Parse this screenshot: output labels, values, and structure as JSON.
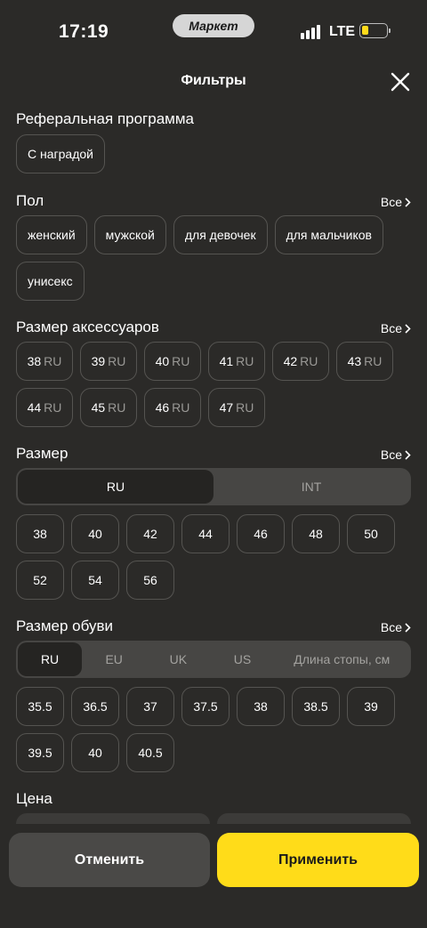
{
  "status_bar": {
    "time": "17:19",
    "brand": "Маркет",
    "network": "LTE",
    "battery_level": 0.25
  },
  "header": {
    "title": "Фильтры",
    "close_icon": "close-icon"
  },
  "see_all_label": "Все",
  "referral": {
    "title": "Реферальная программа",
    "chips": [
      "С наградой"
    ]
  },
  "gender": {
    "title": "Пол",
    "chips": [
      "женский",
      "мужской",
      "для девочек",
      "для мальчиков",
      "унисекс"
    ]
  },
  "accessory_size": {
    "title": "Размер аксессуаров",
    "unit": "RU",
    "values": [
      "38",
      "39",
      "40",
      "41",
      "42",
      "43",
      "44",
      "45",
      "46",
      "47"
    ]
  },
  "size": {
    "title": "Размер",
    "tabs": [
      "RU",
      "INT"
    ],
    "active_tab": "RU",
    "values": [
      "38",
      "40",
      "42",
      "44",
      "46",
      "48",
      "50",
      "52",
      "54",
      "56"
    ]
  },
  "shoe_size": {
    "title": "Размер обуви",
    "tabs": [
      "RU",
      "EU",
      "UK",
      "US",
      "Длина стопы, см"
    ],
    "active_tab": "RU",
    "values": [
      "35.5",
      "36.5",
      "37",
      "37.5",
      "38",
      "38.5",
      "39",
      "39.5",
      "40",
      "40.5"
    ]
  },
  "price": {
    "title": "Цена"
  },
  "actions": {
    "cancel_label": "Отменить",
    "apply_label": "Применить"
  },
  "colors": {
    "background": "#2b2a28",
    "accent": "#ffdc19",
    "chip_border": "#555451"
  }
}
